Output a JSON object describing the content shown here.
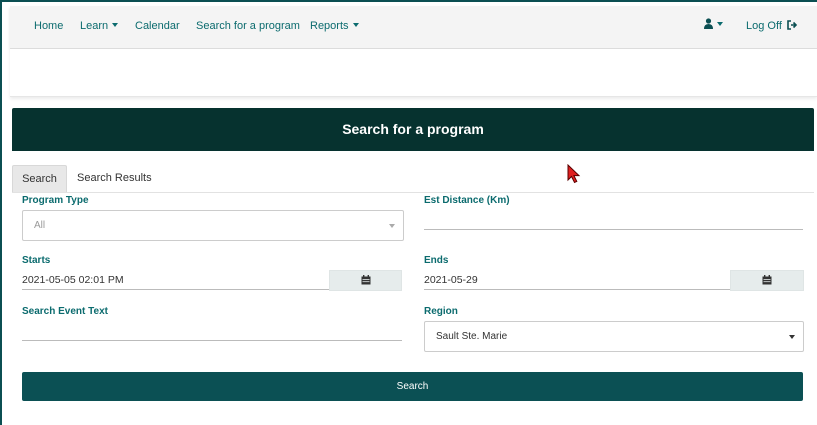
{
  "nav": {
    "home": "Home",
    "learn": "Learn",
    "calendar": "Calendar",
    "search_program": "Search for a program",
    "reports": "Reports",
    "log_off": "Log Off"
  },
  "page": {
    "title": "Search for a program"
  },
  "tabs": [
    {
      "label": "Search",
      "active": true
    },
    {
      "label": "Search Results",
      "active": false
    }
  ],
  "form": {
    "program_type": {
      "label": "Program Type",
      "value": "All"
    },
    "est_distance": {
      "label": "Est Distance (Km)",
      "value": ""
    },
    "starts": {
      "label": "Starts",
      "value": "2021-05-05 02:01 PM"
    },
    "ends": {
      "label": "Ends",
      "value": "2021-05-29"
    },
    "search_event_text": {
      "label": "Search Event Text",
      "value": ""
    },
    "region": {
      "label": "Region",
      "value": "Sault Ste. Marie"
    },
    "search_button": "Search"
  },
  "icons": {
    "user": "user-icon",
    "logoff": "sign-out-icon",
    "calendar": "calendar-icon"
  },
  "colors": {
    "brand": "#06322f",
    "accent": "#0b6b6e",
    "button": "#0b5054"
  }
}
